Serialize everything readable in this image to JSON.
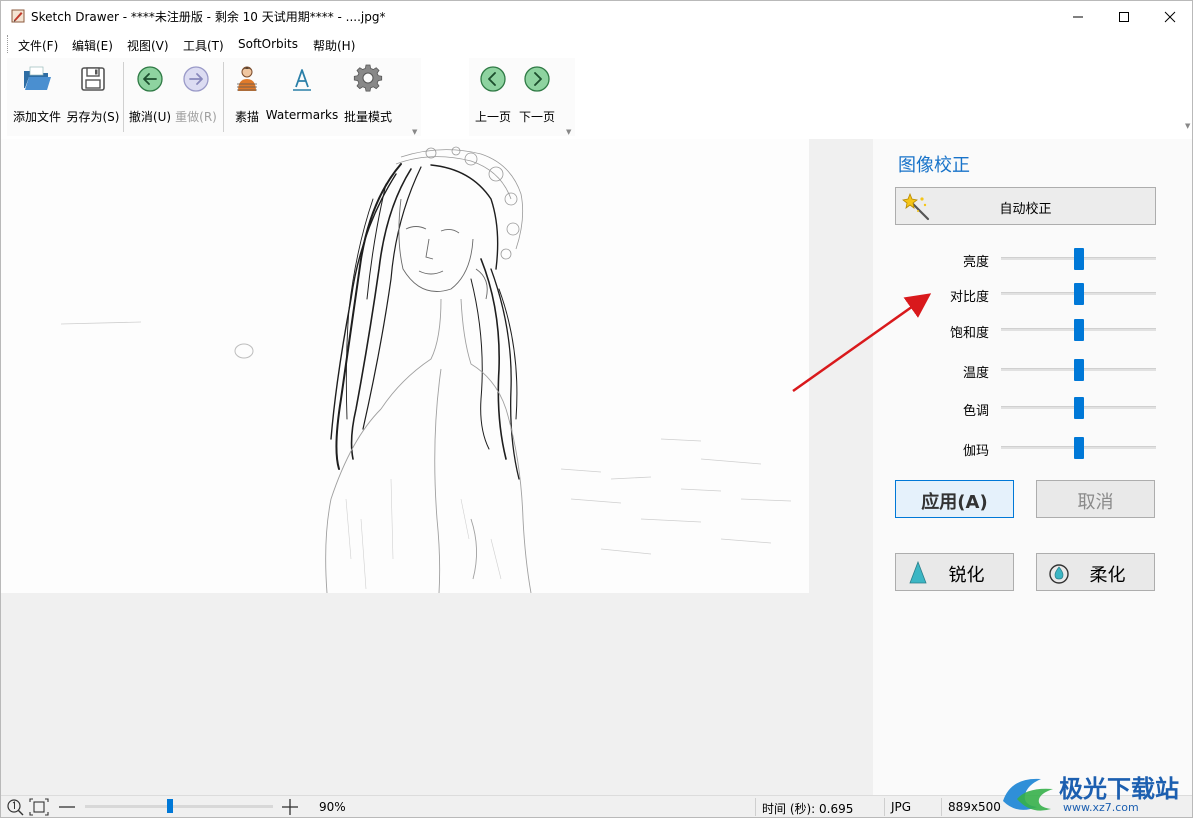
{
  "window": {
    "title": "Sketch Drawer - ****未注册版 - 剩余 10 天试用期**** - ....jpg*"
  },
  "menu": {
    "items": [
      "文件(F)",
      "编辑(E)",
      "视图(V)",
      "工具(T)",
      "SoftOrbits",
      "帮助(H)"
    ]
  },
  "toolbar": {
    "add_file": "添加文件",
    "save_as": "另存为(S)",
    "undo": "撤消(U)",
    "redo": "重做(R)",
    "sketch": "素描",
    "watermarks": "Watermarks",
    "batch": "批量模式",
    "prev_page": "上一页",
    "next_page": "下一页"
  },
  "panel": {
    "title": "图像校正",
    "auto_correct": "自动校正",
    "adjustments": [
      {
        "label": "亮度",
        "value": 0.5
      },
      {
        "label": "对比度",
        "value": 0.5
      },
      {
        "label": "饱和度",
        "value": 0.5
      },
      {
        "label": "温度",
        "value": 0.5
      },
      {
        "label": "色调",
        "value": 0.5
      },
      {
        "label": "伽玛",
        "value": 0.5
      }
    ],
    "apply": "应用(A)",
    "cancel": "取消",
    "sharpen": "锐化",
    "soften": "柔化"
  },
  "status": {
    "zoom_percent": "90%",
    "zoom_value": 0.45,
    "time": "时间 (秒): 0.695",
    "format": "JPG",
    "dimensions": "889x500"
  },
  "watermark": {
    "text": "极光下载站",
    "url": "www.xz7.com"
  },
  "colors": {
    "accent": "#0078d7",
    "title_blue": "#1873c9",
    "arrow_red": "#d9191c"
  }
}
